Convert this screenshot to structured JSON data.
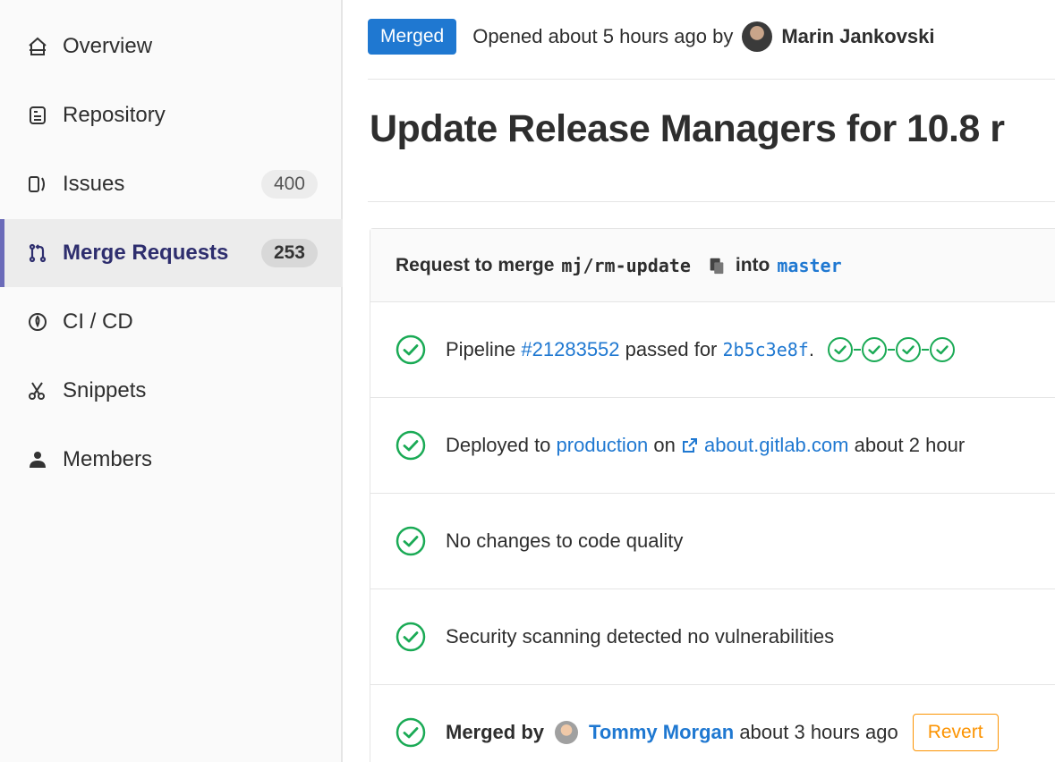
{
  "sidebar": {
    "items": [
      {
        "label": "Overview",
        "icon": "home-icon"
      },
      {
        "label": "Repository",
        "icon": "document-icon"
      },
      {
        "label": "Issues",
        "icon": "issues-icon",
        "count": "400"
      },
      {
        "label": "Merge Requests",
        "icon": "merge-request-icon",
        "count": "253",
        "active": true
      },
      {
        "label": "CI / CD",
        "icon": "rocket-icon"
      },
      {
        "label": "Snippets",
        "icon": "scissors-icon"
      },
      {
        "label": "Members",
        "icon": "user-icon"
      }
    ]
  },
  "header": {
    "status": "Merged",
    "opened_text": "Opened about 5 hours ago by",
    "author": "Marin Jankovski"
  },
  "title": "Update Release Managers for 10.8 r",
  "merge": {
    "prefix": "Request to merge",
    "source_branch": "mj/rm-update",
    "into": "into",
    "target_branch": "master"
  },
  "pipeline": {
    "prefix": "Pipeline",
    "id": "#21283552",
    "middle": "passed for",
    "sha": "2b5c3e8f",
    "suffix": ".",
    "stage_count": 4
  },
  "deploy": {
    "prefix": "Deployed to",
    "environment": "production",
    "on": "on",
    "url": "about.gitlab.com",
    "time": "about 2 hour"
  },
  "code_quality": "No changes to code quality",
  "security": "Security scanning detected no vulnerabilities",
  "merged_by": {
    "prefix": "Merged by",
    "user": "Tommy Morgan",
    "time": "about 3 hours ago",
    "revert_label": "Revert"
  },
  "colors": {
    "accent": "#1f78d1",
    "success": "#1aaa55",
    "warning": "#fc9403",
    "active_nav": "#2e2e6e"
  }
}
